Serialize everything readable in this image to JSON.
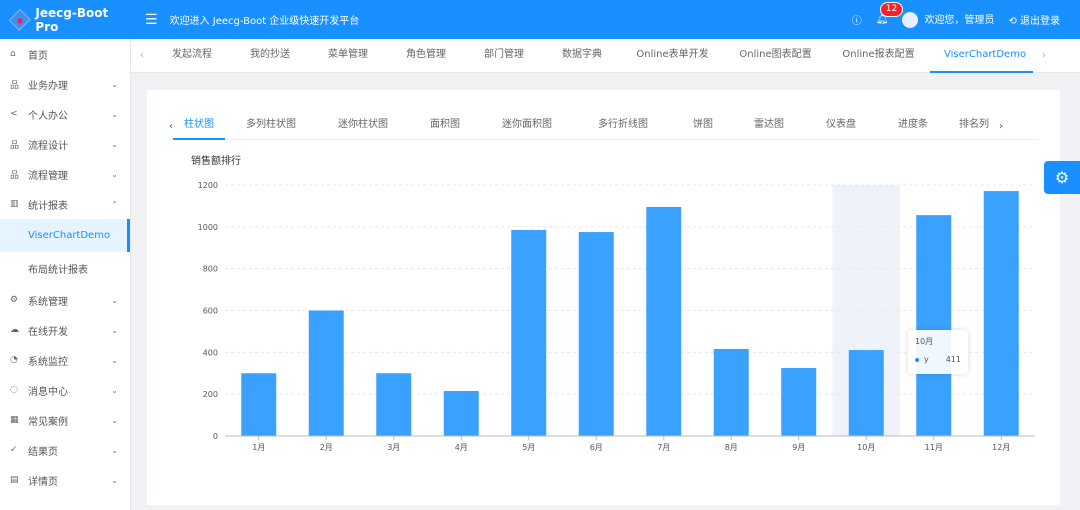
{
  "header": {
    "logo": "Jeecg-Boot Pro",
    "welcome": "欢迎进入 Jeecg-Boot 企业级快速开发平台",
    "notification_count": "12",
    "user": "欢迎您，管理员",
    "logout": "退出登录"
  },
  "sidebar": {
    "items": [
      {
        "label": "首页",
        "icon": "home-icon"
      },
      {
        "label": "业务办理",
        "icon": "apartment-icon"
      },
      {
        "label": "个人办公",
        "icon": "share-icon"
      },
      {
        "label": "流程设计",
        "icon": "apartment-icon"
      },
      {
        "label": "流程管理",
        "icon": "apartment-icon"
      },
      {
        "label": "统计报表",
        "icon": "chart-icon"
      },
      {
        "label": "ViserChartDemo"
      },
      {
        "label": "布局统计报表"
      },
      {
        "label": "系统管理",
        "icon": "gear-icon"
      },
      {
        "label": "在线开发",
        "icon": "cloud-icon"
      },
      {
        "label": "系统监控",
        "icon": "dashboard-icon"
      },
      {
        "label": "消息中心",
        "icon": "message-icon"
      },
      {
        "label": "常见案例",
        "icon": "table-icon"
      },
      {
        "label": "结果页",
        "icon": "check-circle-icon"
      },
      {
        "label": "详情页",
        "icon": "profile-icon"
      }
    ]
  },
  "tabs": [
    "发起流程",
    "我的抄送",
    "菜单管理",
    "角色管理",
    "部门管理",
    "数据字典",
    "Online表单开发",
    "Online图表配置",
    "Online报表配置",
    "ViserChartDemo"
  ],
  "chart_tabs": [
    "柱状图",
    "多列柱状图",
    "迷你柱状图",
    "面积图",
    "迷你面积图",
    "多行折线图",
    "饼图",
    "雷达图",
    "仪表盘",
    "进度条",
    "排名列"
  ],
  "colors": {
    "primary": "#1890ff",
    "bar": "#3ba1ff"
  },
  "chart_data": {
    "type": "bar",
    "title": "销售额排行",
    "categories": [
      "1月",
      "2月",
      "3月",
      "4月",
      "5月",
      "6月",
      "7月",
      "8月",
      "9月",
      "10月",
      "11月",
      "12月"
    ],
    "values": [
      300,
      600,
      300,
      215,
      985,
      975,
      1095,
      416,
      325,
      411,
      1056,
      1171
    ],
    "ylim": [
      0,
      1200
    ],
    "yticks": [
      "0",
      "200",
      "400",
      "600",
      "800",
      "1000",
      "1200"
    ],
    "grid": true,
    "tooltip": {
      "title": "10月",
      "series": "y",
      "value": "411"
    }
  }
}
